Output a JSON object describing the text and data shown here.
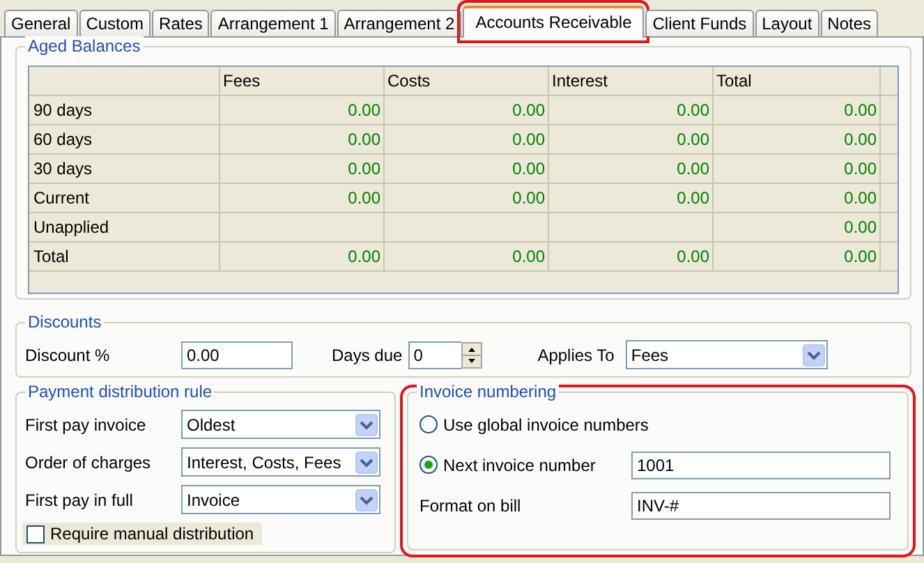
{
  "tabs": [
    {
      "label": "General",
      "selected": false,
      "highlighted": false
    },
    {
      "label": "Custom",
      "selected": false,
      "highlighted": false
    },
    {
      "label": "Rates",
      "selected": false,
      "highlighted": false
    },
    {
      "label": "Arrangement 1",
      "selected": false,
      "highlighted": false
    },
    {
      "label": "Arrangement 2",
      "selected": false,
      "highlighted": false
    },
    {
      "label": "Accounts Receivable",
      "selected": true,
      "highlighted": true
    },
    {
      "label": "Client Funds",
      "selected": false,
      "highlighted": false
    },
    {
      "label": "Layout",
      "selected": false,
      "highlighted": false
    },
    {
      "label": "Notes",
      "selected": false,
      "highlighted": false
    }
  ],
  "aged_balances": {
    "title": "Aged Balances",
    "columns": [
      "Fees",
      "Costs",
      "Interest",
      "Total"
    ],
    "rows": [
      {
        "label": "90 days",
        "cells": [
          "0.00",
          "0.00",
          "0.00",
          "0.00"
        ]
      },
      {
        "label": "60 days",
        "cells": [
          "0.00",
          "0.00",
          "0.00",
          "0.00"
        ]
      },
      {
        "label": "30 days",
        "cells": [
          "0.00",
          "0.00",
          "0.00",
          "0.00"
        ]
      },
      {
        "label": "Current",
        "cells": [
          "0.00",
          "0.00",
          "0.00",
          "0.00"
        ]
      },
      {
        "label": "Unapplied",
        "cells": [
          null,
          null,
          null,
          "0.00"
        ]
      },
      {
        "label": "Total",
        "cells": [
          "0.00",
          "0.00",
          "0.00",
          "0.00"
        ]
      }
    ]
  },
  "discounts": {
    "title": "Discounts",
    "discount_percent": {
      "label": "Discount %",
      "value": "0.00"
    },
    "days_due": {
      "label": "Days due",
      "value": "0"
    },
    "applies_to": {
      "label": "Applies To",
      "value": "Fees"
    }
  },
  "payment_distribution": {
    "title": "Payment distribution rule",
    "rows": [
      {
        "label": "First pay invoice",
        "value": "Oldest"
      },
      {
        "label": "Order of charges",
        "value": "Interest, Costs, Fees"
      },
      {
        "label": "First pay in full",
        "value": "Invoice"
      }
    ],
    "checkbox": {
      "label": "Require manual distribution",
      "checked": false
    }
  },
  "invoice_numbering": {
    "title": "Invoice numbering",
    "highlighted": true,
    "options": [
      {
        "label": "Use global invoice numbers",
        "selected": false
      },
      {
        "label": "Next invoice number",
        "selected": true,
        "value": "1001"
      }
    ],
    "format": {
      "label": "Format on bill",
      "value": "INV-#"
    }
  }
}
